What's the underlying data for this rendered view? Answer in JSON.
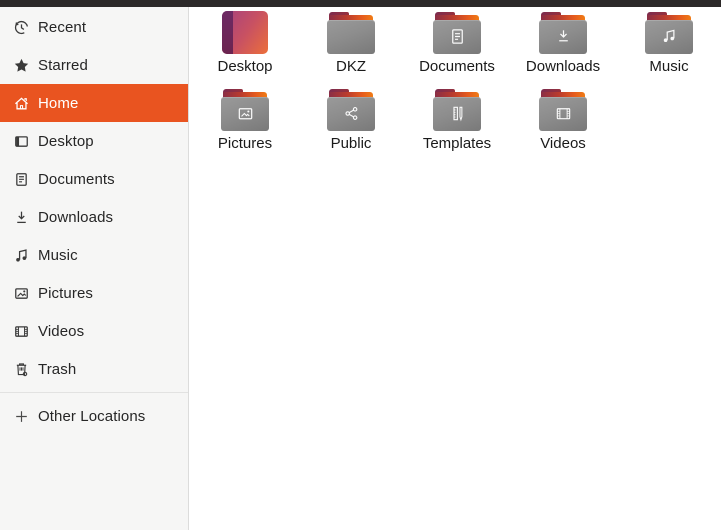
{
  "colors": {
    "accent_orange": "#E95420",
    "top_edge": "#2C2929",
    "sidebar_bg": "#F6F6F5",
    "main_bg": "#FFFFFF",
    "sidebar_text": "#262626",
    "selected_text": "#FFFFFF",
    "file_label_text": "#1A1A1A",
    "folder_gray_top": "#9A9A9A",
    "folder_gray_bottom": "#797979",
    "folder_tab_maroon": "#7C2B4E",
    "folder_strip_orange": "#F07C15",
    "desktop_icon_purple": "#A5417F",
    "desktop_icon_orange": "#EC6F3A"
  },
  "sidebar": {
    "items": [
      {
        "label": "Recent",
        "icon": "clock-icon",
        "selected": false
      },
      {
        "label": "Starred",
        "icon": "star-icon",
        "selected": false
      },
      {
        "label": "Home",
        "icon": "home-icon",
        "selected": true
      },
      {
        "label": "Desktop",
        "icon": "desktop-panel-icon",
        "selected": false
      },
      {
        "label": "Documents",
        "icon": "document-icon",
        "selected": false
      },
      {
        "label": "Downloads",
        "icon": "download-icon",
        "selected": false
      },
      {
        "label": "Music",
        "icon": "music-note-icon",
        "selected": false
      },
      {
        "label": "Pictures",
        "icon": "picture-icon",
        "selected": false
      },
      {
        "label": "Videos",
        "icon": "film-icon",
        "selected": false
      },
      {
        "label": "Trash",
        "icon": "trash-icon",
        "selected": false
      }
    ],
    "other_locations": {
      "label": "Other Locations",
      "icon": "plus-icon"
    }
  },
  "files": {
    "view": "icon-grid",
    "selected_location": "Home",
    "items": [
      {
        "name": "Desktop",
        "icon": "desktop-gradient-icon",
        "type": "folder"
      },
      {
        "name": "DKZ",
        "icon": "folder-icon",
        "type": "folder"
      },
      {
        "name": "Documents",
        "icon": "folder-documents-icon",
        "type": "folder"
      },
      {
        "name": "Downloads",
        "icon": "folder-downloads-icon",
        "type": "folder"
      },
      {
        "name": "Music",
        "icon": "folder-music-icon",
        "type": "folder"
      },
      {
        "name": "Pictures",
        "icon": "folder-pictures-icon",
        "type": "folder"
      },
      {
        "name": "Public",
        "icon": "folder-share-icon",
        "type": "folder"
      },
      {
        "name": "Templates",
        "icon": "folder-templates-icon",
        "type": "folder"
      },
      {
        "name": "Videos",
        "icon": "folder-videos-icon",
        "type": "folder"
      }
    ]
  }
}
